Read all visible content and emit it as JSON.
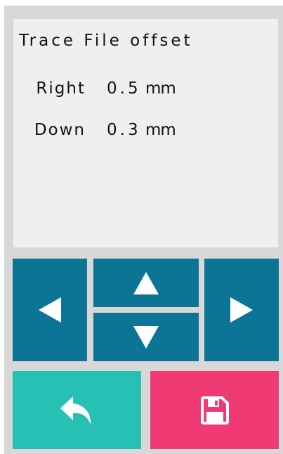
{
  "screen": {
    "title": "Trace File offset",
    "offsets": [
      {
        "label": "Right",
        "value": "0.5",
        "unit": "mm"
      },
      {
        "label": "Down",
        "value": "0.3",
        "unit": "mm"
      }
    ]
  },
  "controls": {
    "icons": {
      "left": "arrow-left-icon",
      "up": "arrow-up-icon",
      "down": "arrow-down-icon",
      "right": "arrow-right-icon",
      "back": "undo-icon",
      "save": "save-icon"
    }
  },
  "colors": {
    "device_bezel": "#d9d7d7",
    "display_bg": "#efefef",
    "arrow_buttons": "#0c7494",
    "back_button": "#26c0b4",
    "save_button": "#ef3a73",
    "icon": "#ffffff"
  }
}
